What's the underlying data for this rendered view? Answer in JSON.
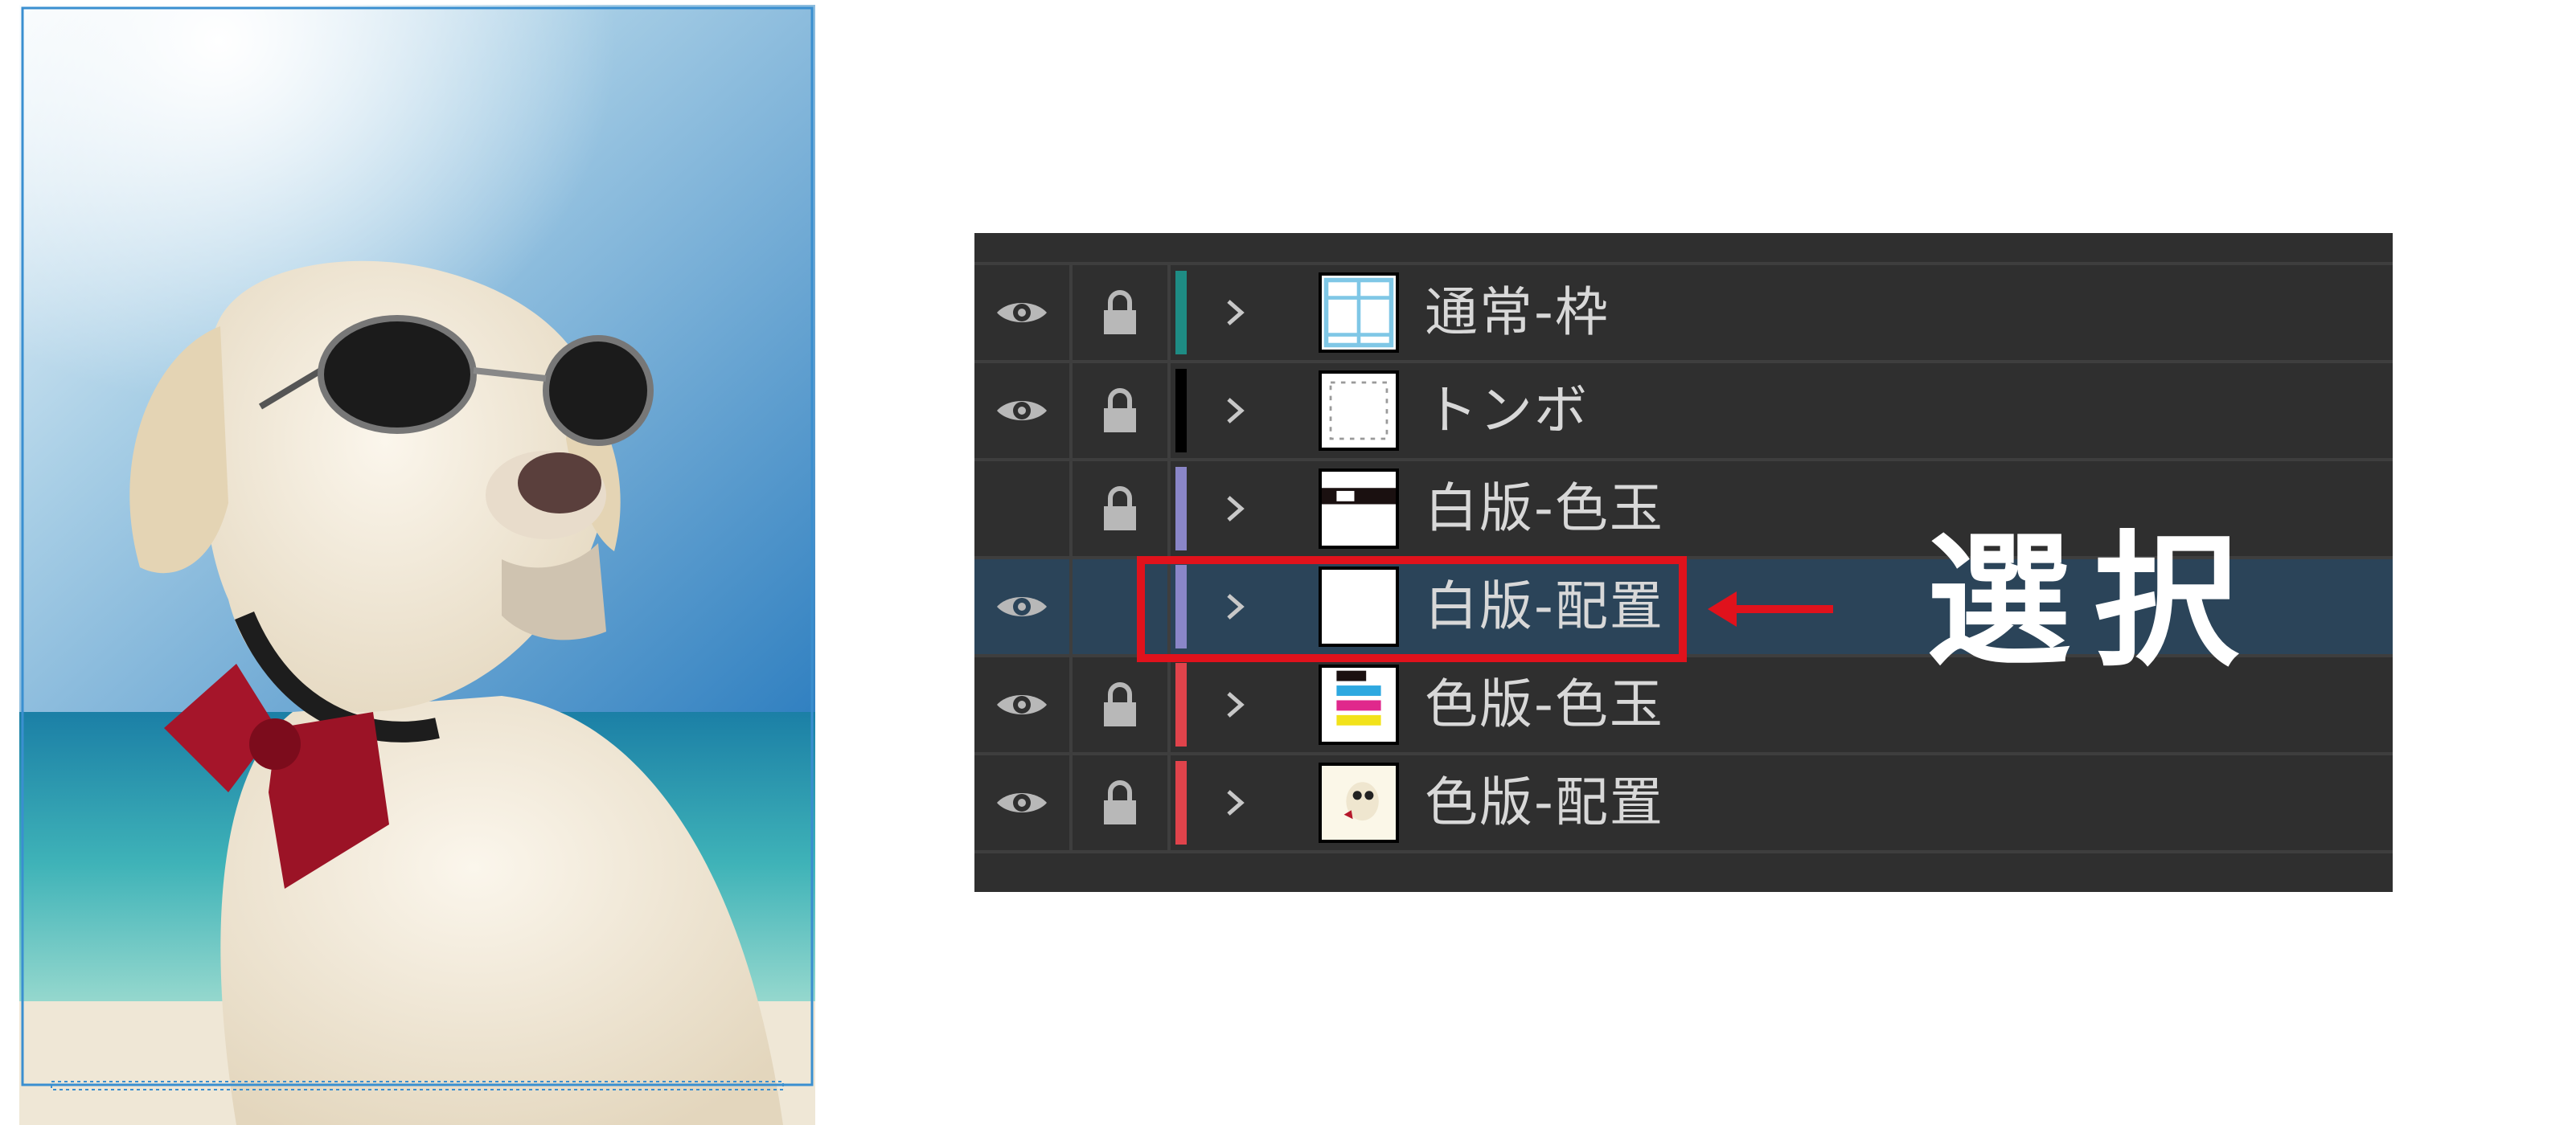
{
  "layers_panel": {
    "layers": [
      {
        "name": "通常-枠",
        "visible": true,
        "locked": true,
        "color": "#1e8c84",
        "thumb": "frame-grid-thumb",
        "selected": false
      },
      {
        "name": "トンボ",
        "visible": true,
        "locked": true,
        "color": "#000000",
        "thumb": "trim-marks-thumb",
        "selected": false
      },
      {
        "name": "白版-色玉",
        "visible": false,
        "locked": true,
        "color": "#8a86c8",
        "thumb": "white-swatch-thumb",
        "selected": false
      },
      {
        "name": "白版-配置",
        "visible": true,
        "locked": false,
        "color": "#8a86c8",
        "thumb": "blank-thumb",
        "selected": true
      },
      {
        "name": "色版-色玉",
        "visible": true,
        "locked": true,
        "color": "#e0434b",
        "thumb": "cmyk-swatch-thumb",
        "selected": false
      },
      {
        "name": "色版-配置",
        "visible": true,
        "locked": true,
        "color": "#e0434b",
        "thumb": "dog-art-thumb",
        "selected": false
      }
    ]
  },
  "annotation": {
    "label": "選択",
    "color": "#e0121c"
  }
}
